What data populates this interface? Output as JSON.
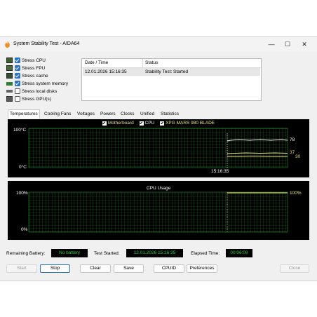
{
  "window": {
    "title": "System Stability Test - AIDA64",
    "minimize": "—",
    "maximize": "☐",
    "close": "✕"
  },
  "stress_options": [
    {
      "label": "Stress CPU",
      "checked": true,
      "icon": "cpu-icon"
    },
    {
      "label": "Stress FPU",
      "checked": true,
      "icon": "fpu-icon"
    },
    {
      "label": "Stress cache",
      "checked": true,
      "icon": "cache-icon"
    },
    {
      "label": "Stress system memory",
      "checked": true,
      "icon": "memory-icon"
    },
    {
      "label": "Stress local disks",
      "checked": false,
      "icon": "disk-icon"
    },
    {
      "label": "Stress GPU(s)",
      "checked": false,
      "icon": "gpu-icon"
    }
  ],
  "status_table": {
    "headers": [
      "Date / Time",
      "Status"
    ],
    "rows": [
      [
        "12.01.2026 15:16:35",
        "Stability Test: Started"
      ]
    ]
  },
  "tabs": [
    "Temperatures",
    "Cooling Fans",
    "Voltages",
    "Powers",
    "Clocks",
    "Unified",
    "Statistics"
  ],
  "active_tab": "Temperatures",
  "temperature_chart": {
    "legend": [
      {
        "label": "Motherboard",
        "color": "#e8e0a0"
      },
      {
        "label": "CPU",
        "color": "#ffffff"
      },
      {
        "label": "XPG MARS 980 BLADE",
        "color": "#f0e68c"
      }
    ],
    "y_max_label": "100°C",
    "y_min_label": "0°C",
    "x_label": "15:16:35",
    "value_labels": [
      {
        "text": "78",
        "color": "#ffffff"
      },
      {
        "text": "37",
        "color": "#e8d870"
      },
      {
        "text": "30",
        "color": "#e8d870"
      }
    ]
  },
  "cpu_chart": {
    "title": "CPU Usage",
    "y_max_label": "100%",
    "y_min_label": "0%",
    "value_label": "100%",
    "value_color": "#f0e68c"
  },
  "bottom": {
    "remaining_battery_label": "Remaining Battery:",
    "remaining_battery_value": "No battery",
    "test_started_label": "Test Started:",
    "test_started_value": "12.01.2026 15:16:35",
    "elapsed_label": "Elapsed Time:",
    "elapsed_value": "00:06:08"
  },
  "buttons": {
    "start": "Start",
    "stop": "Stop",
    "clear": "Clear",
    "save": "Save",
    "cpuid": "CPUID",
    "preferences": "Preferences",
    "close": "Close"
  },
  "colors": {
    "grid": "#1f7a1f",
    "lcd_text": "#2ecc40",
    "accent": "#2c72c7"
  }
}
